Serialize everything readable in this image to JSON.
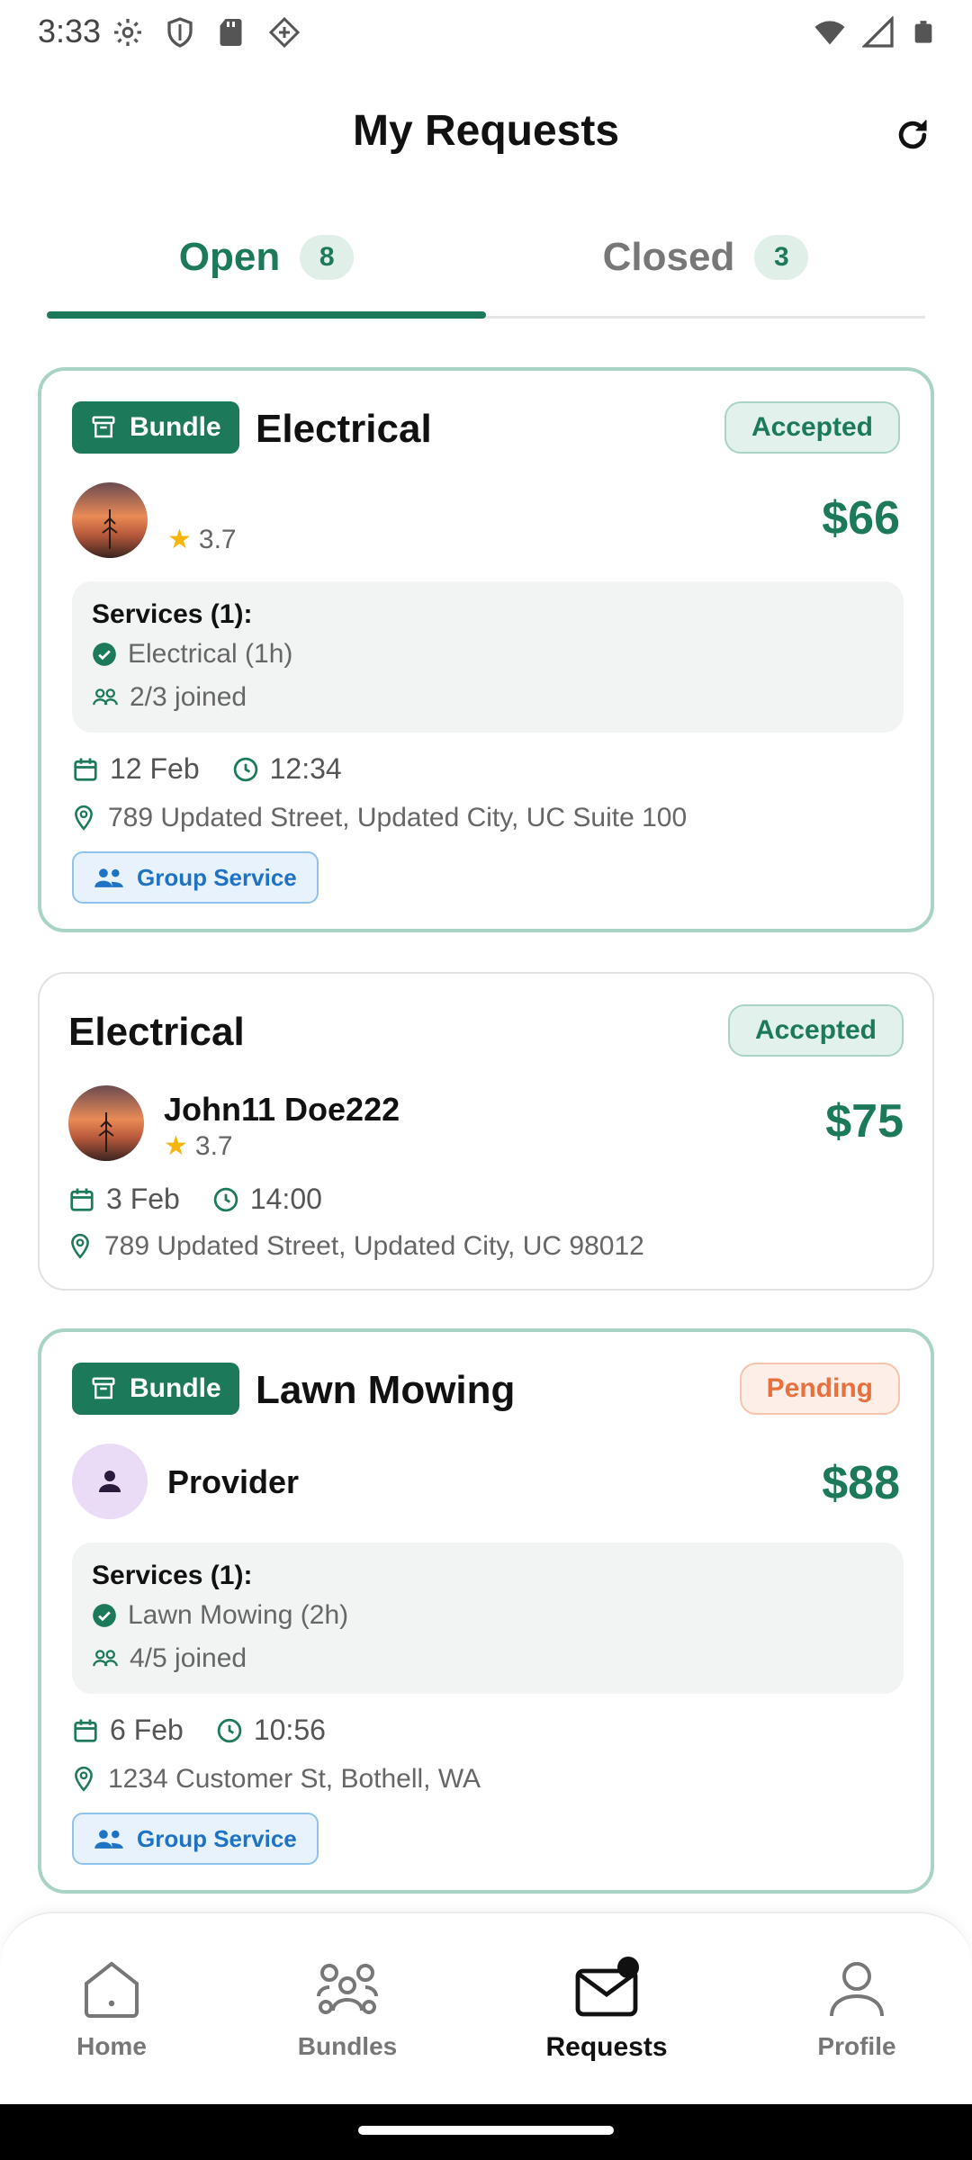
{
  "status_bar": {
    "time": "3:33"
  },
  "header": {
    "title": "My Requests"
  },
  "tabs": [
    {
      "label": "Open",
      "count": "8",
      "active": true
    },
    {
      "label": "Closed",
      "count": "3",
      "active": false
    }
  ],
  "cards": [
    {
      "bundle_label": "Bundle",
      "title": "Electrical",
      "status": "Accepted",
      "provider_name": "",
      "rating": "3.7",
      "price": "$66",
      "services_title": "Services (1):",
      "service_item": "Electrical (1h)",
      "joined": "2/3 joined",
      "date": "12 Feb",
      "time": "12:34",
      "address": "789 Updated Street, Updated City, UC Suite 100",
      "group_label": "Group Service"
    },
    {
      "title": "Electrical",
      "status": "Accepted",
      "provider_name": "John11 Doe222",
      "rating": "3.7",
      "price": "$75",
      "date": "3 Feb",
      "time": "14:00",
      "address": "789 Updated Street, Updated City, UC 98012"
    },
    {
      "bundle_label": "Bundle",
      "title": "Lawn Mowing",
      "status": "Pending",
      "provider_name": "Provider",
      "price": "$88",
      "services_title": "Services (1):",
      "service_item": "Lawn Mowing (2h)",
      "joined": "4/5 joined",
      "date": "6 Feb",
      "time": "10:56",
      "address": "1234 Customer St, Bothell, WA",
      "group_label": "Group Service"
    }
  ],
  "bottom_nav": [
    {
      "label": "Home",
      "icon": "home-icon",
      "active": false
    },
    {
      "label": "Bundles",
      "icon": "bundles-icon",
      "active": false
    },
    {
      "label": "Requests",
      "icon": "mail-icon",
      "active": true
    },
    {
      "label": "Profile",
      "icon": "profile-icon",
      "active": false
    }
  ],
  "colors": {
    "primary": "#1c7a5b",
    "pending": "#e8703c",
    "group_blue": "#1f73c4",
    "star": "#f5b50a"
  }
}
